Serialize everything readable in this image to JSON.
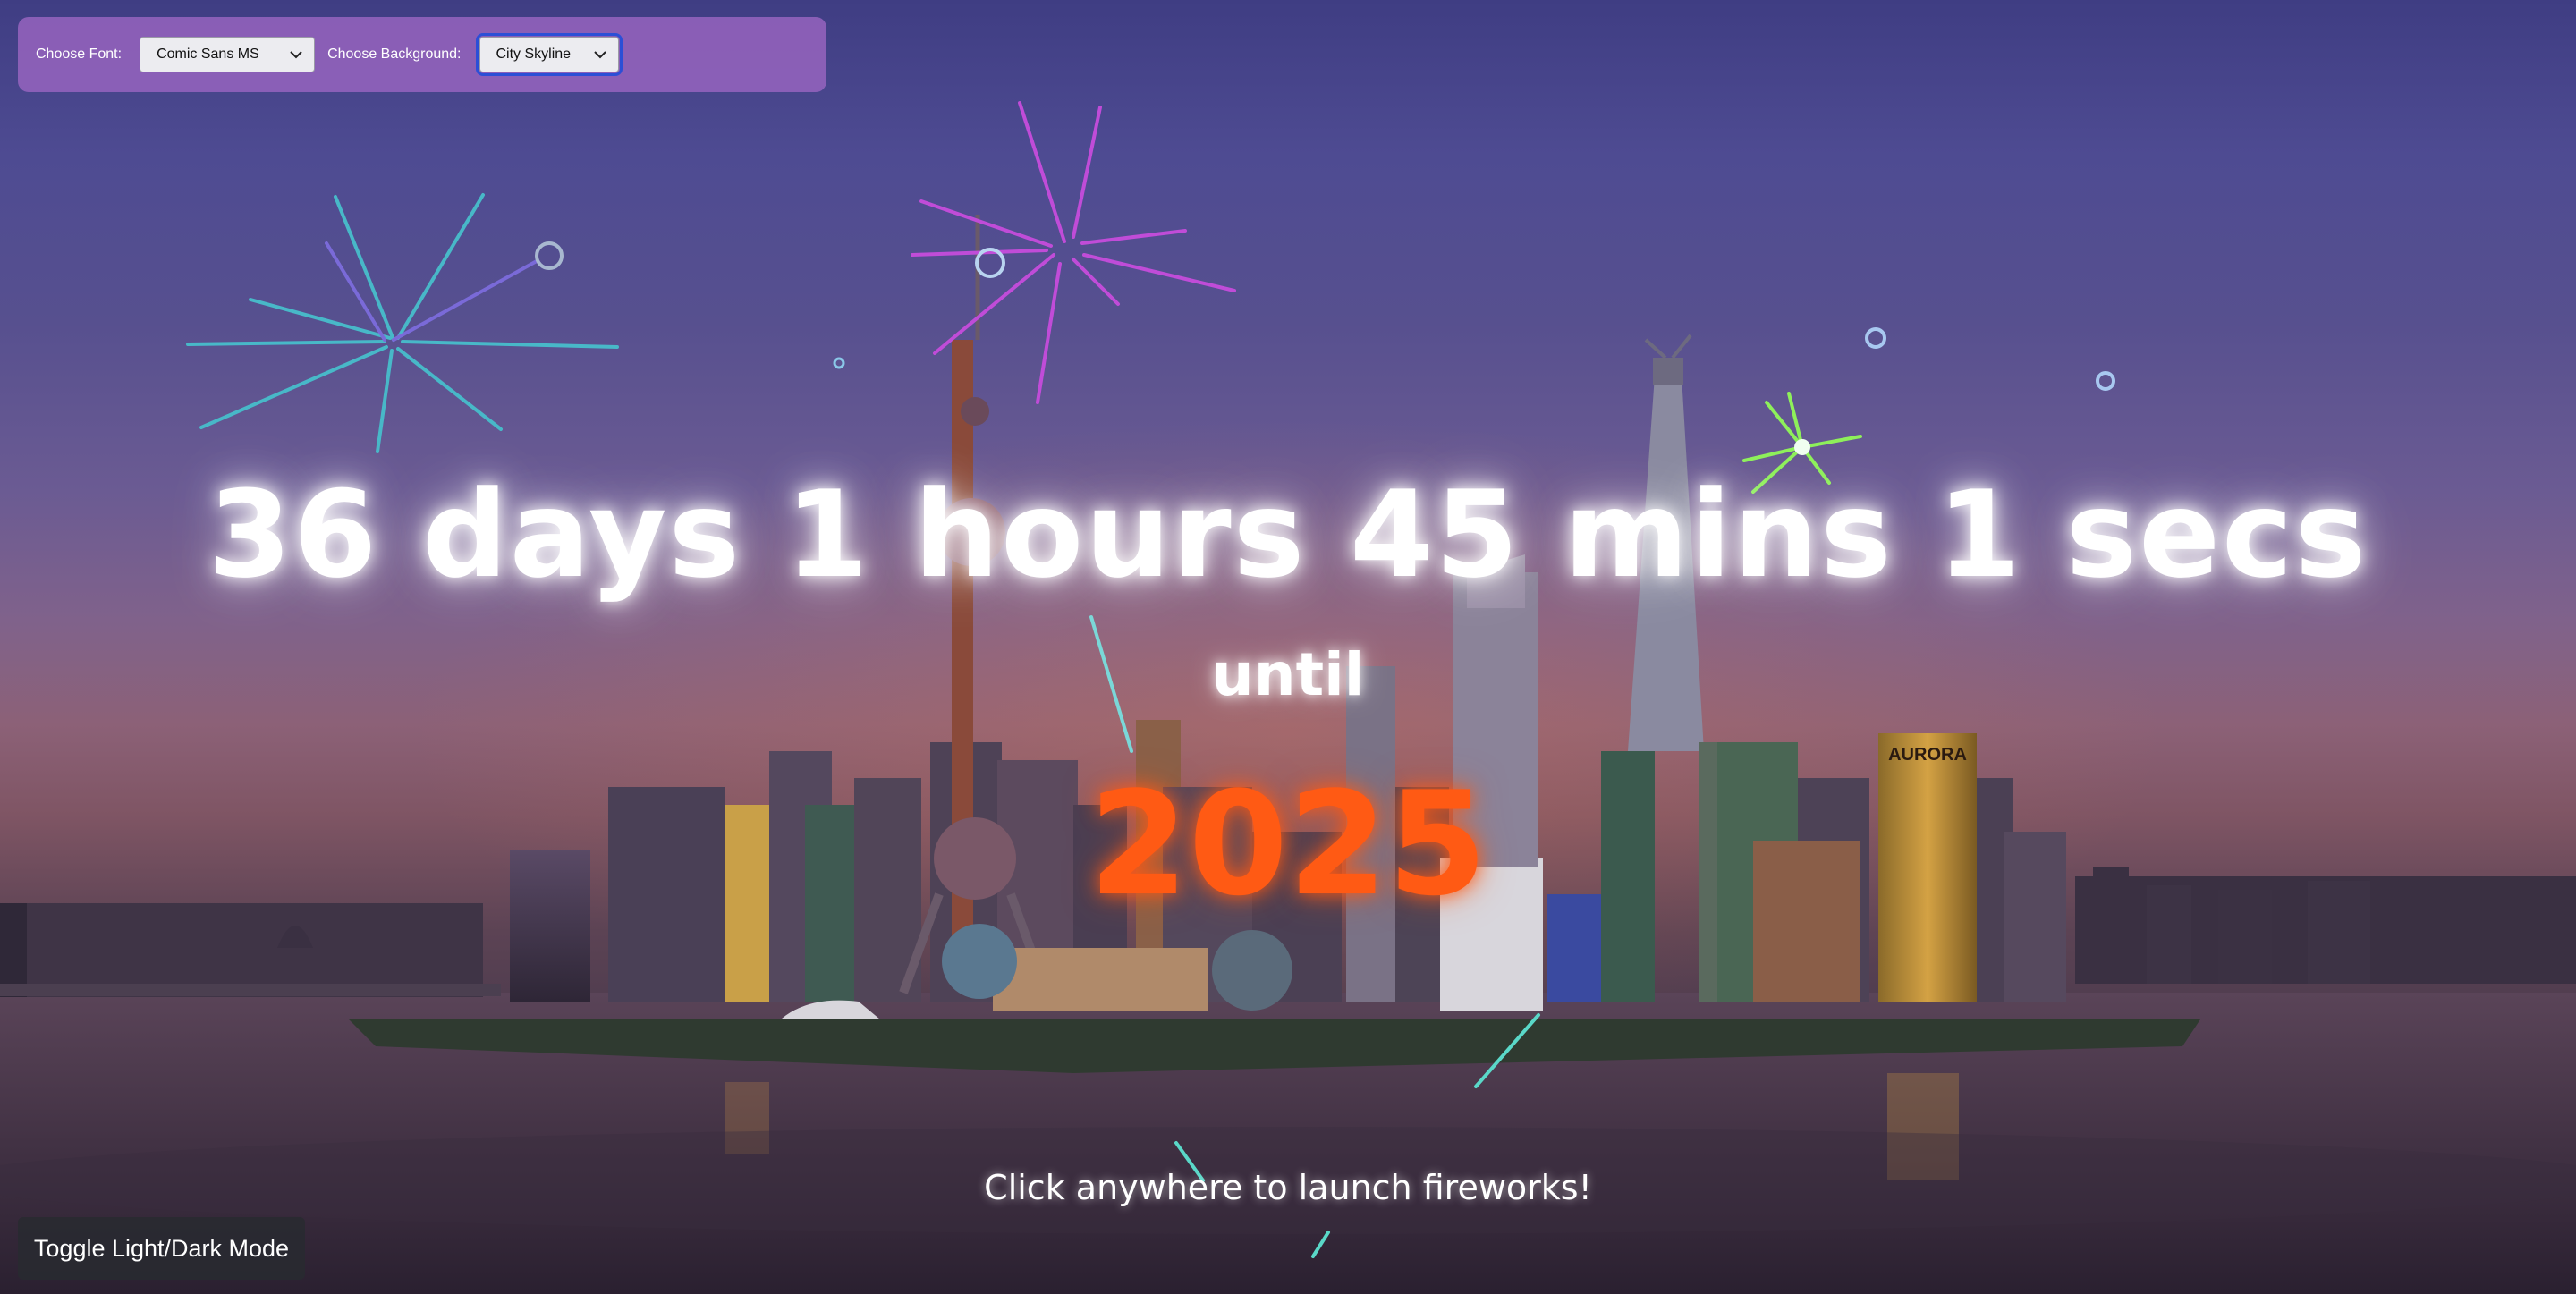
{
  "controls": {
    "font_label": "Choose Font:",
    "font_value": "Comic Sans MS",
    "background_label": "Choose Background:",
    "background_value": "City Skyline"
  },
  "countdown": {
    "text": "36 days 1 hours 45 mins 1 secs",
    "until_text": "until",
    "target_year": "2025"
  },
  "hint_text": "Click anywhere to launch fireworks!",
  "toggle_button_label": "Toggle Light/Dark Mode",
  "background_image": {
    "building_sign_text": "AURORA"
  },
  "colors": {
    "panel": "#9664be",
    "year": "#ff5a14",
    "text": "#ffffff",
    "toggle_button": "#282a30",
    "focus_outline": "#2c4fd6"
  }
}
